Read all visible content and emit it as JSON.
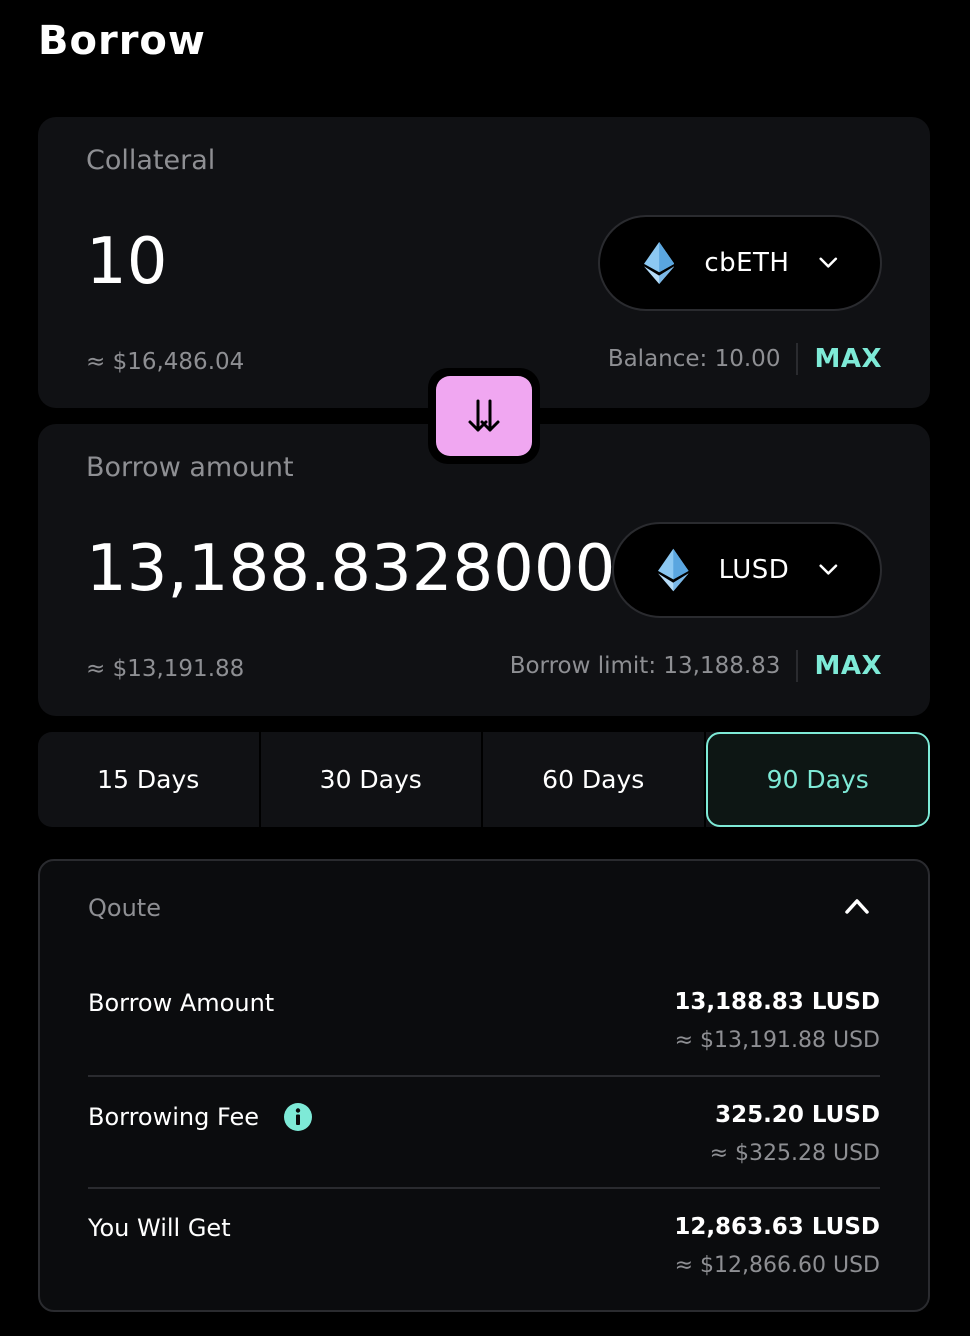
{
  "title": "Borrow",
  "collateral": {
    "label": "Collateral",
    "amount": "10",
    "usd": "≈ $16,486.04",
    "token": "cbETH",
    "balance": "Balance: 10.00",
    "max_label": "MAX"
  },
  "borrow": {
    "label": "Borrow amount",
    "amount": "13,188.83280000",
    "usd": "≈ $13,191.88",
    "token": "LUSD",
    "limit": "Borrow limit: 13,188.83",
    "max_label": "MAX"
  },
  "terms": {
    "options": [
      "15 Days",
      "30 Days",
      "60 Days",
      "90 Days"
    ],
    "selected": "90 Days"
  },
  "quote": {
    "title": "Qoute",
    "rows": [
      {
        "label": "Borrow Amount",
        "value": "13,188.83 LUSD",
        "sub": "≈ $13,191.88 USD"
      },
      {
        "label": "Borrowing Fee",
        "value": "325.20 LUSD",
        "sub": "≈ $325.28 USD"
      },
      {
        "label": "You Will Get",
        "value": "12,863.63 LUSD",
        "sub": "≈ $12,866.60 USD"
      }
    ]
  },
  "colors": {
    "accent": "#7eead7",
    "swap_button": "#f0a7f1",
    "card_bg": "#101114",
    "muted_text": "#8e8f93",
    "eth_icon": "#6fb4ea"
  },
  "icons": {
    "token": "ethereum-icon",
    "swap": "swap-arrows-icon",
    "dropdown": "chevron-down-icon",
    "collapse": "chevron-up-icon",
    "info": "info-icon"
  }
}
